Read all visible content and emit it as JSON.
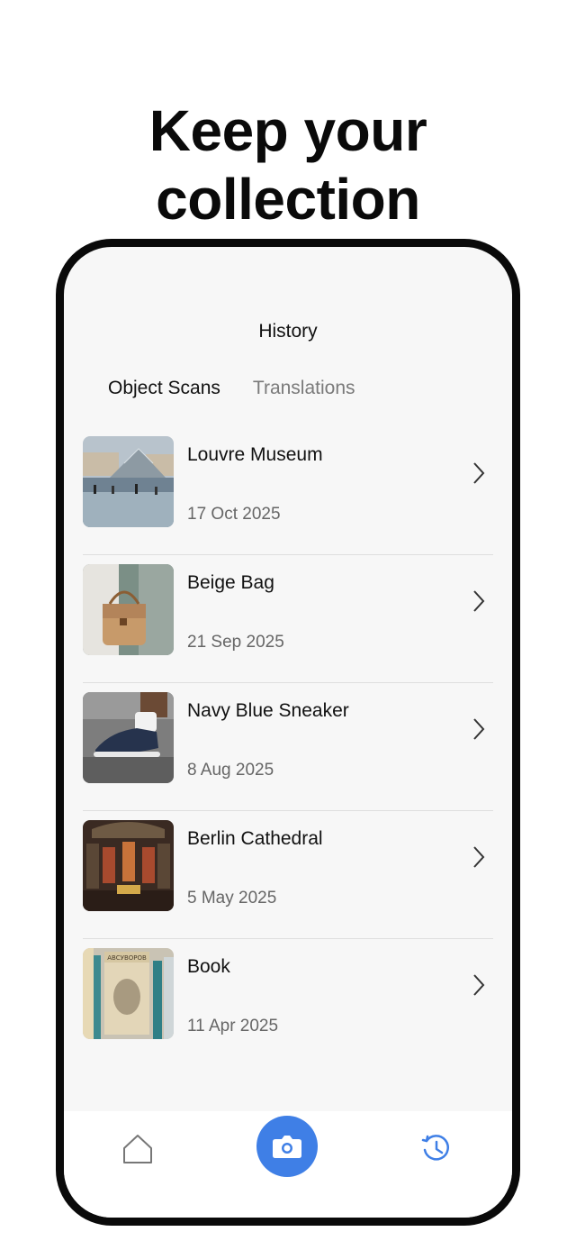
{
  "hero": {
    "line1": "Keep your",
    "line2": "collection"
  },
  "screen": {
    "title": "History",
    "tabs": [
      {
        "label": "Object Scans",
        "active": true
      },
      {
        "label": "Translations",
        "active": false
      }
    ]
  },
  "scans": [
    {
      "name": "Louvre Museum",
      "date": "17 Oct 2025",
      "thumbnail": "louvre-pyramid-photo"
    },
    {
      "name": "Beige Bag",
      "date": "21 Sep 2025",
      "thumbnail": "beige-bag-photo"
    },
    {
      "name": "Navy Blue Sneaker",
      "date": "8 Aug 2025",
      "thumbnail": "navy-sneaker-photo"
    },
    {
      "name": "Berlin Cathedral",
      "date": "5 May 2025",
      "thumbnail": "berlin-cathedral-photo"
    },
    {
      "name": "Book",
      "date": "11 Apr 2025",
      "thumbnail": "book-photo"
    }
  ],
  "thumbnail_text": {
    "book_spine": "АВСУВОРОВ"
  },
  "nav": {
    "items": [
      "home-icon",
      "camera-icon",
      "history-icon"
    ],
    "active": "history-icon"
  },
  "colors": {
    "accent": "#3f7fe6",
    "frame": "#0a0a0a",
    "screen_bg": "#f7f7f7",
    "inactive_tab": "#7a7a7a",
    "secondary_text": "#666666"
  }
}
